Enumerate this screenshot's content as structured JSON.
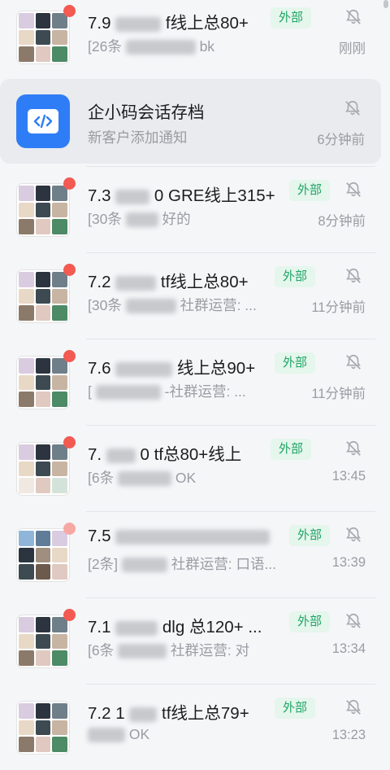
{
  "colors": {
    "accent": "#2f7df6",
    "badge_green": "#1fa565",
    "unread_dot": "#f25a52"
  },
  "conversations": [
    {
      "title_start": "7.9",
      "title_end": "f线上总80+",
      "badge": "外部",
      "preview_start": "[26条",
      "preview_end": "bk",
      "time": "刚刚",
      "unread": true,
      "muted": true
    },
    {
      "title_start": "企小码会话存档",
      "title_end": "",
      "badge": "",
      "preview_start": "新客户添加通知",
      "preview_end": "",
      "time": "6分钟前",
      "unread": false,
      "muted": true,
      "icon": "code-app-icon"
    },
    {
      "title_start": "7.3",
      "title_end": "0 GRE线上315+",
      "badge": "外部",
      "preview_start": "[30条",
      "preview_end": "好的",
      "time": "8分钟前",
      "unread": true,
      "muted": true
    },
    {
      "title_start": "7.2",
      "title_end": "tf线上总80+",
      "badge": "外部",
      "preview_start": "[30条",
      "preview_end": "社群运营: ...",
      "time": "11分钟前",
      "unread": true,
      "muted": true
    },
    {
      "title_start": "7.6",
      "title_end": "线上总90+",
      "badge": "外部",
      "preview_start": "[",
      "preview_end": "-社群运营: ...",
      "time": "11分钟前",
      "unread": true,
      "muted": true
    },
    {
      "title_start": "7.",
      "title_end": "0 tf总80+线上",
      "badge": "外部",
      "preview_start": "[6条",
      "preview_end": "OK",
      "time": "13:45",
      "unread": true,
      "muted": true
    },
    {
      "title_start": "7.5",
      "title_end": "",
      "badge": "外部",
      "preview_start": "[2条]",
      "preview_end": "社群运营: 口语...",
      "time": "13:39",
      "unread": true,
      "muted": true
    },
    {
      "title_start": "7.1",
      "title_end": "dlg 总120+ ...",
      "badge": "外部",
      "preview_start": "[6条",
      "preview_end": "社群运营: 对",
      "time": "13:34",
      "unread": true,
      "muted": true
    },
    {
      "title_start": "7.2 1",
      "title_end": "tf线上总79+",
      "badge": "外部",
      "preview_start": "",
      "preview_end": "OK",
      "time": "13:23",
      "unread": false,
      "muted": true
    }
  ]
}
